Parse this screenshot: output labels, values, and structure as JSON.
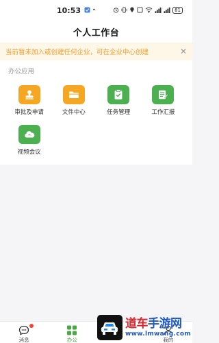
{
  "status_bar": {
    "time": "10:53",
    "battery": "81"
  },
  "header": {
    "title": "个人工作台"
  },
  "notice": {
    "text": "当前暂未加入或创建任何企业，可在企业中心创建",
    "close_icon": "close-icon"
  },
  "apps": {
    "section_title": "办公应用",
    "items": [
      {
        "label": "审批及申请",
        "icon": "stamp-icon",
        "color": "#f5a623"
      },
      {
        "label": "文件中心",
        "icon": "folder-icon",
        "color": "#f5a623"
      },
      {
        "label": "任务管理",
        "icon": "clipboard-check-icon",
        "color": "#4caf50"
      },
      {
        "label": "工作汇报",
        "icon": "report-icon",
        "color": "#4caf50"
      },
      {
        "label": "视频会议",
        "icon": "cloud-icon",
        "color": "#4caf50"
      }
    ]
  },
  "tabs": [
    {
      "label": "消息",
      "icon": "chat-icon",
      "badge": true
    },
    {
      "label": "办公",
      "icon": "grid-icon",
      "active": true
    },
    {
      "label": "",
      "icon": ""
    },
    {
      "label": "我的",
      "icon": "person-icon"
    }
  ],
  "watermark": {
    "title_part1": "道车",
    "title_part2": "手游网",
    "url": "www.lmwang.com"
  },
  "colors": {
    "accent_green": "#4aa842",
    "accent_orange": "#f5a623",
    "notice_text": "#f0a030",
    "notice_bg": "#fef6e6",
    "badge_red": "#f44336"
  }
}
